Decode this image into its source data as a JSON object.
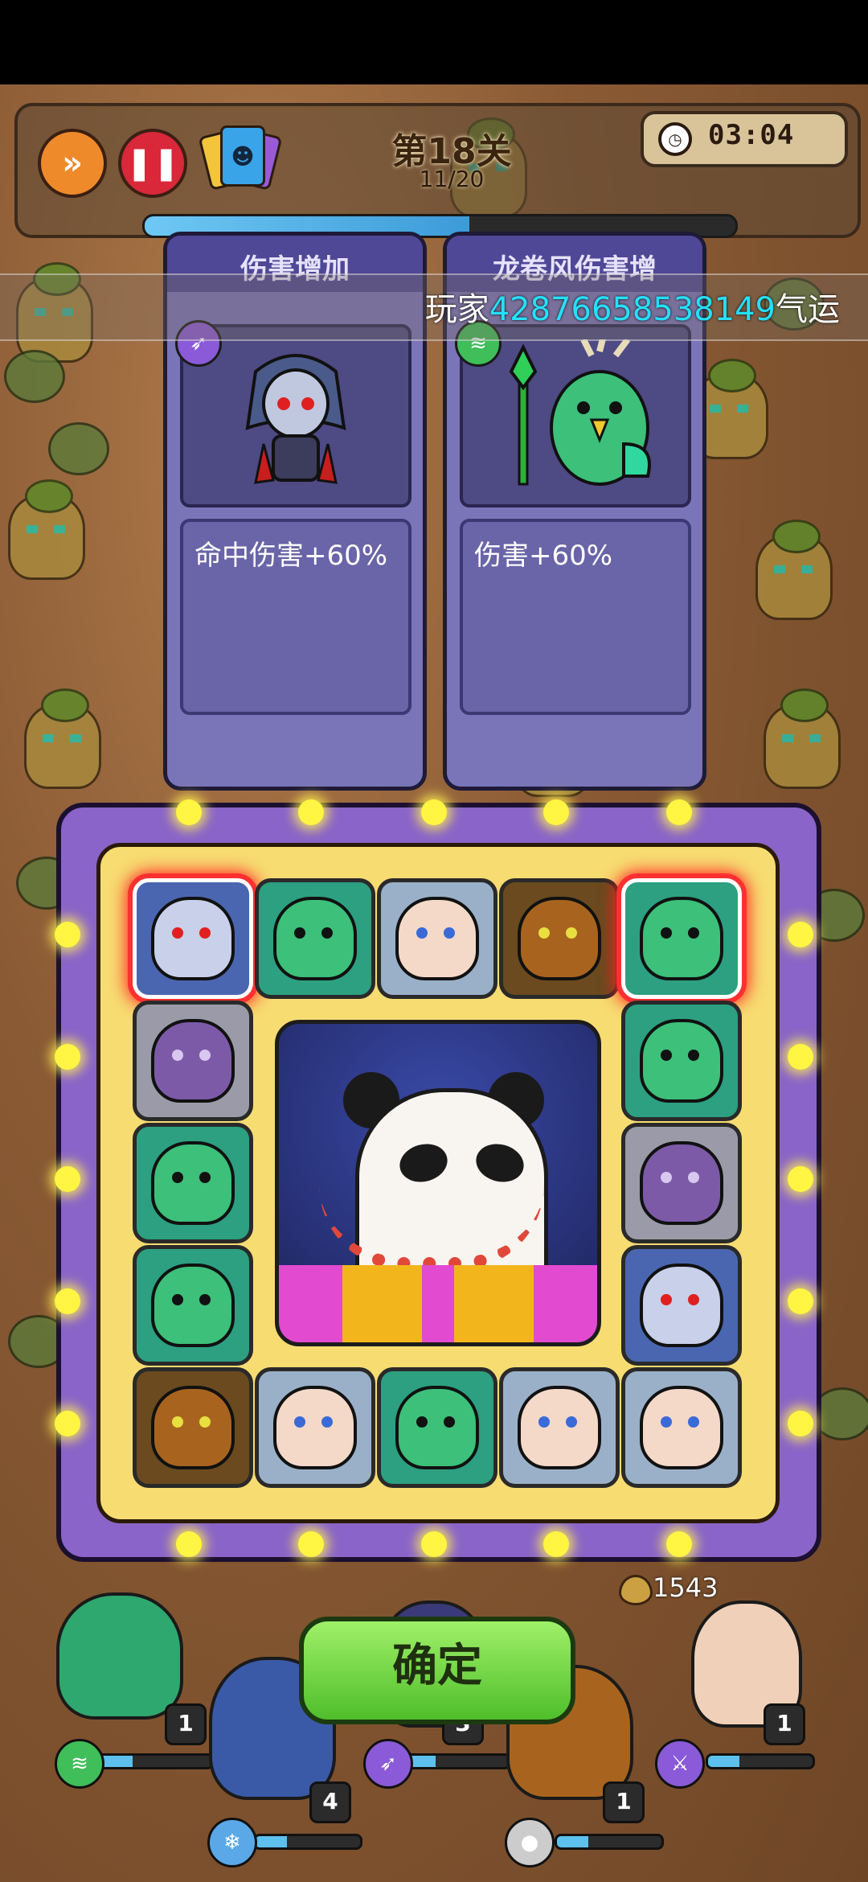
{
  "hud": {
    "level_title": "第18关",
    "wave_progress_text": "11/20",
    "wave_progress_fraction": 0.55,
    "timer": "03:04",
    "fast_forward_icon": "fast-forward-icon",
    "pause_icon": "pause-icon"
  },
  "upgrade_cards": [
    {
      "title": "伤害增加",
      "description": "命中伤害+60%",
      "hero": "dark-elf-archer",
      "badge_icon": "arrow-icon",
      "badge_color": "#8a5ad8"
    },
    {
      "title": "龙卷风伤害增",
      "description": "伤害+60%",
      "hero": "green-owl-mage",
      "badge_icon": "tornado-icon",
      "badge_color": "#3fbe5a"
    }
  ],
  "player_banner": {
    "prefix": "玩家",
    "player_id": "42876658538149",
    "suffix": "气运"
  },
  "board": {
    "grid_tiles": [
      {
        "hero": "dark-elf-archer",
        "highlighted": true
      },
      {
        "hero": "green-owl-mage",
        "highlighted": false
      },
      {
        "hero": "white-beard-king",
        "highlighted": false
      },
      {
        "hero": "tree-ent",
        "highlighted": false
      },
      {
        "hero": "green-owl-mage",
        "highlighted": true
      },
      {
        "hero": "purple-gear",
        "highlighted": false
      },
      {
        "hero": "green-owl-mage",
        "highlighted": false
      },
      {
        "hero": "green-owl-mage",
        "highlighted": false
      },
      {
        "hero": "purple-gear",
        "highlighted": false
      },
      {
        "hero": "green-owl-mage",
        "highlighted": false
      },
      {
        "hero": "dark-elf-archer",
        "highlighted": false
      },
      {
        "hero": "tree-ent",
        "highlighted": false
      },
      {
        "hero": "white-beard-king",
        "highlighted": false
      },
      {
        "hero": "green-owl-mage",
        "highlighted": false
      },
      {
        "hero": "white-beard-king",
        "highlighted": false
      },
      {
        "hero": "white-beard-king",
        "highlighted": false
      }
    ],
    "center_prize": "panda-treasure"
  },
  "confirm_button": {
    "label": "确定"
  },
  "gold": {
    "amount": "1543",
    "icon": "heart-icon"
  },
  "heroes": [
    {
      "name": "green-owl-mage",
      "level": "1",
      "hp_fraction": 0.3,
      "skill_icon": "tornado-icon"
    },
    {
      "name": "ice-knight",
      "level": "4",
      "hp_fraction": 0.3,
      "skill_icon": "ice-icon"
    },
    {
      "name": "dark-elf-archer",
      "level": "3",
      "hp_fraction": 0.3,
      "skill_icon": "arrow-icon"
    },
    {
      "name": "tree-ent",
      "level": "1",
      "hp_fraction": 0.3,
      "skill_icon": "ball-icon"
    },
    {
      "name": "white-beard-king",
      "level": "1",
      "hp_fraction": 0.3,
      "skill_icon": "sword-icon"
    }
  ],
  "colors": {
    "highlight": "#ff3030",
    "confirm_green": "#6fd83a",
    "board_purple": "#8a64c8",
    "board_yellow": "#f7dc72",
    "player_id_cyan": "#24e0ff"
  }
}
